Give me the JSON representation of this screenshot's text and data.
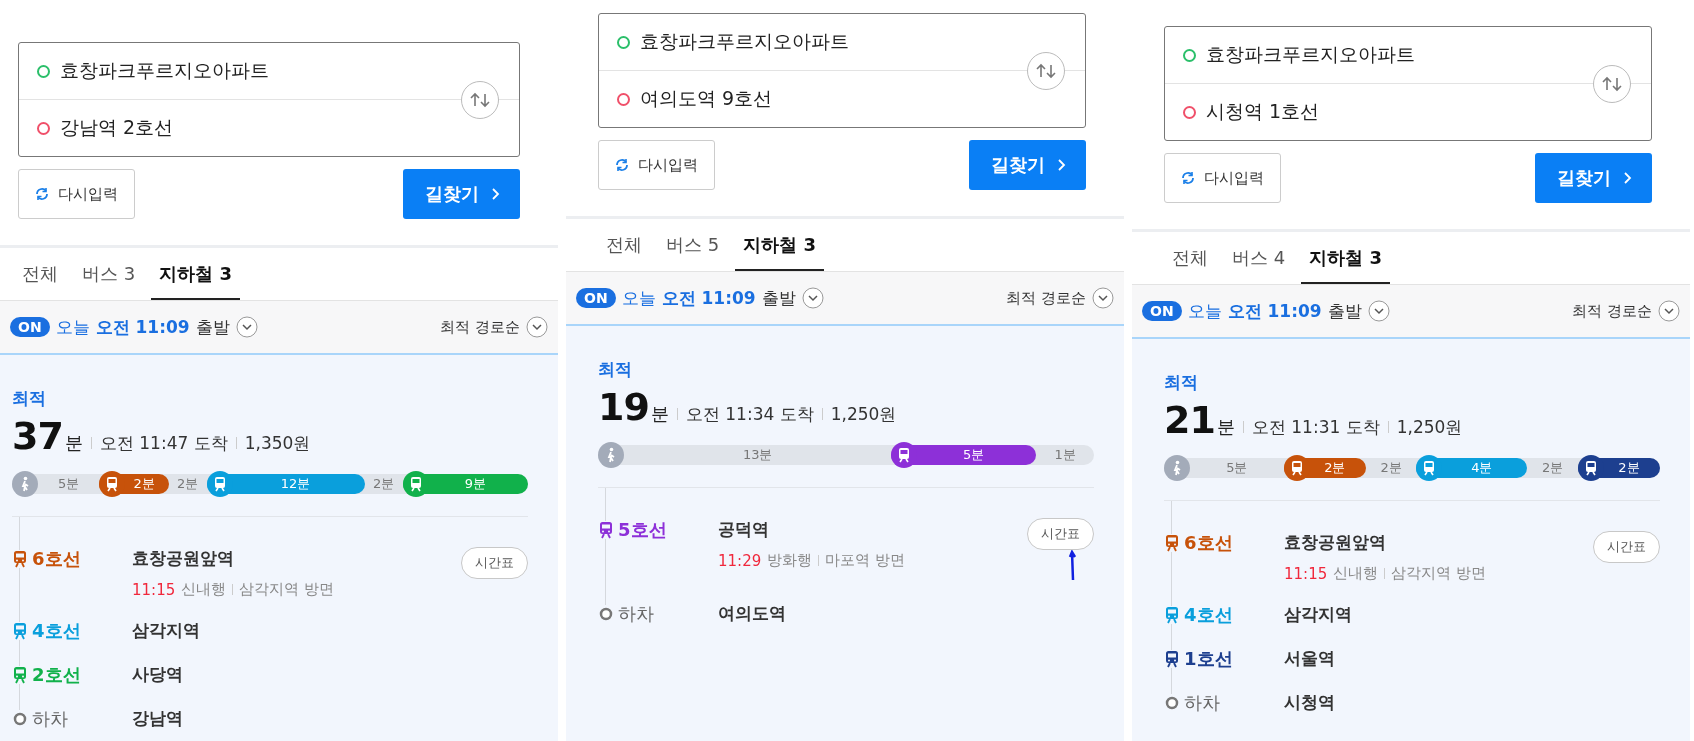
{
  "panels": [
    {
      "origin": "효창파크푸르지오아파트",
      "destination": "강남역 2호선",
      "reset_button": "다시입력",
      "search_button": "길찾기",
      "tabs": [
        {
          "label": "전체",
          "selected": false
        },
        {
          "label": "버스 3",
          "selected": false
        },
        {
          "label": "지하철 3",
          "selected": true
        }
      ],
      "filter": {
        "badge": "ON",
        "day": "오늘",
        "time": "오전 11:09",
        "mode": "출발",
        "sort": "최적 경로순"
      },
      "result": {
        "tag": "최적",
        "minutes": "37",
        "unit": "분",
        "arrival": "오전 11:47 도착",
        "fare": "1,350원",
        "segments": [
          {
            "kind": "walk",
            "label": "5분"
          },
          {
            "kind": "ride",
            "label": "2분",
            "color": "#c7520a"
          },
          {
            "kind": "gap",
            "label": "2분"
          },
          {
            "kind": "ride",
            "label": "12분",
            "color": "#0a9fdc"
          },
          {
            "kind": "gap",
            "label": "2분"
          },
          {
            "kind": "ride",
            "label": "9분",
            "color": "#11b14b"
          }
        ],
        "steps": [
          {
            "kind": "ride",
            "line": "6호선",
            "color": "#c7520a",
            "station": "효창공원앞역",
            "departure": "11:15",
            "bound": "신내행",
            "direction": "삼각지역 방면",
            "timetable": "시간표"
          },
          {
            "kind": "ride",
            "line": "4호선",
            "color": "#0a9fdc",
            "station": "삼각지역"
          },
          {
            "kind": "ride",
            "line": "2호선",
            "color": "#11b14b",
            "station": "사당역"
          },
          {
            "kind": "alight",
            "line": "하차",
            "station": "강남역"
          }
        ]
      },
      "annotation": false
    },
    {
      "origin": "효창파크푸르지오아파트",
      "destination": "여의도역 9호선",
      "reset_button": "다시입력",
      "search_button": "길찾기",
      "tabs": [
        {
          "label": "전체",
          "selected": false
        },
        {
          "label": "버스 5",
          "selected": false
        },
        {
          "label": "지하철 3",
          "selected": true
        }
      ],
      "filter": {
        "badge": "ON",
        "day": "오늘",
        "time": "오전 11:09",
        "mode": "출발",
        "sort": "최적 경로순"
      },
      "result": {
        "tag": "최적",
        "minutes": "19",
        "unit": "분",
        "arrival": "오전 11:34 도착",
        "fare": "1,250원",
        "segments": [
          {
            "kind": "walk",
            "label": "13분"
          },
          {
            "kind": "ride",
            "label": "5분",
            "color": "#8d30d8"
          },
          {
            "kind": "gap",
            "label": "1분"
          }
        ],
        "steps": [
          {
            "kind": "ride",
            "line": "5호선",
            "color": "#8d30d8",
            "station": "공덕역",
            "departure": "11:29",
            "bound": "방화행",
            "direction": "마포역 방면",
            "timetable": "시간표"
          },
          {
            "kind": "alight",
            "line": "하차",
            "station": "여의도역"
          }
        ]
      },
      "annotation": true
    },
    {
      "origin": "효창파크푸르지오아파트",
      "destination": "시청역 1호선",
      "reset_button": "다시입력",
      "search_button": "길찾기",
      "tabs": [
        {
          "label": "전체",
          "selected": false
        },
        {
          "label": "버스 4",
          "selected": false
        },
        {
          "label": "지하철 3",
          "selected": true
        }
      ],
      "filter": {
        "badge": "ON",
        "day": "오늘",
        "time": "오전 11:09",
        "mode": "출발",
        "sort": "최적 경로순"
      },
      "result": {
        "tag": "최적",
        "minutes": "21",
        "unit": "분",
        "arrival": "오전 11:31 도착",
        "fare": "1,250원",
        "segments": [
          {
            "kind": "walk",
            "label": "5분"
          },
          {
            "kind": "ride",
            "label": "2분",
            "color": "#c7520a"
          },
          {
            "kind": "gap",
            "label": "2분"
          },
          {
            "kind": "ride",
            "label": "4분",
            "color": "#0a9fdc"
          },
          {
            "kind": "gap",
            "label": "2분"
          },
          {
            "kind": "ride",
            "label": "2분",
            "color": "#1d3f8f"
          }
        ],
        "steps": [
          {
            "kind": "ride",
            "line": "6호선",
            "color": "#c7520a",
            "station": "효창공원앞역",
            "departure": "11:15",
            "bound": "신내행",
            "direction": "삼각지역 방면",
            "timetable": "시간표"
          },
          {
            "kind": "ride",
            "line": "4호선",
            "color": "#0a9fdc",
            "station": "삼각지역"
          },
          {
            "kind": "ride",
            "line": "1호선",
            "color": "#1d3f8f",
            "station": "서울역"
          },
          {
            "kind": "alight",
            "line": "하차",
            "station": "시청역"
          }
        ]
      },
      "annotation": false
    }
  ]
}
